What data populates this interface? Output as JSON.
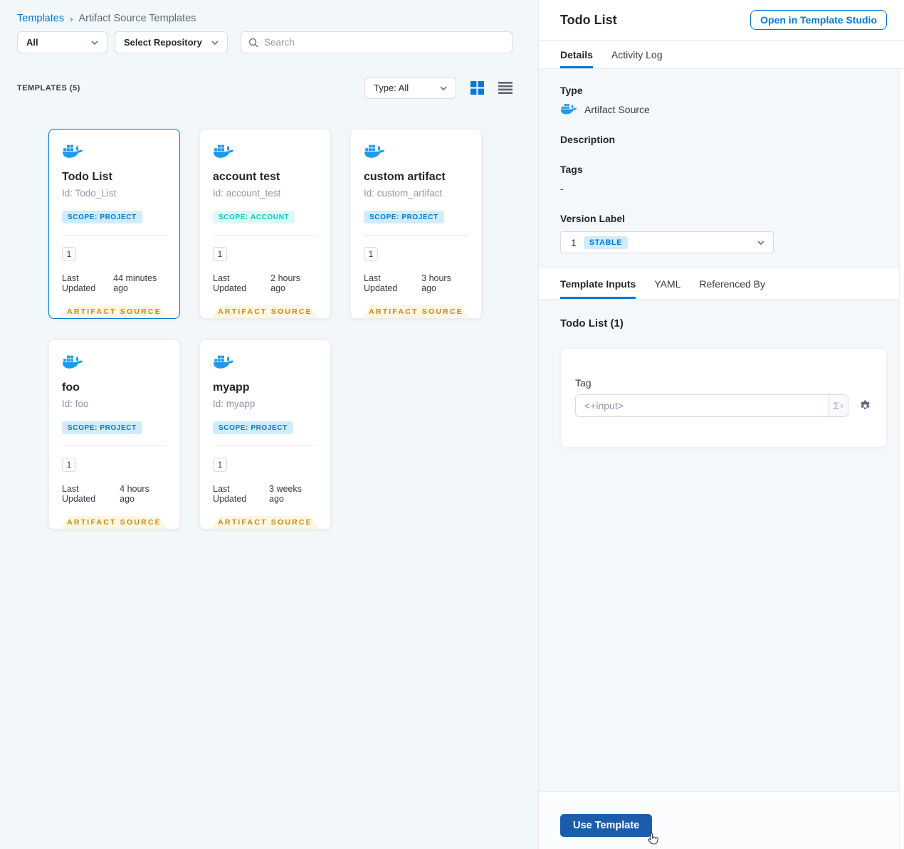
{
  "breadcrumb": {
    "root": "Templates",
    "separator": "›",
    "current": "Artifact Source Templates"
  },
  "filters": {
    "scope": "All",
    "repository": "Select Repository",
    "search_placeholder": "Search"
  },
  "list_header": {
    "count": "TEMPLATES (5)",
    "type_filter": "Type: All"
  },
  "cards": [
    {
      "title": "Todo List",
      "id": "Id: Todo_List",
      "scope": "SCOPE: PROJECT",
      "scope_type": "project",
      "version_count": "1",
      "updated_label": "Last Updated",
      "updated_value": "44 minutes ago",
      "ribbon": "ARTIFACT SOURCE",
      "selected": true
    },
    {
      "title": "account test",
      "id": "Id: account_test",
      "scope": "SCOPE: ACCOUNT",
      "scope_type": "account",
      "version_count": "1",
      "updated_label": "Last Updated",
      "updated_value": "2 hours ago",
      "ribbon": "ARTIFACT SOURCE",
      "selected": false
    },
    {
      "title": "custom artifact",
      "id": "Id: custom_artifact",
      "scope": "SCOPE: PROJECT",
      "scope_type": "project",
      "version_count": "1",
      "updated_label": "Last Updated",
      "updated_value": "3 hours ago",
      "ribbon": "ARTIFACT SOURCE",
      "selected": false
    },
    {
      "title": "foo",
      "id": "Id: foo",
      "scope": "SCOPE: PROJECT",
      "scope_type": "project",
      "version_count": "1",
      "updated_label": "Last Updated",
      "updated_value": "4 hours ago",
      "ribbon": "ARTIFACT SOURCE",
      "selected": false
    },
    {
      "title": "myapp",
      "id": "Id: myapp",
      "scope": "SCOPE: PROJECT",
      "scope_type": "project",
      "version_count": "1",
      "updated_label": "Last Updated",
      "updated_value": "3 weeks ago",
      "ribbon": "ARTIFACT SOURCE",
      "selected": false
    }
  ],
  "panel": {
    "title": "Todo List",
    "open_button": "Open in Template Studio",
    "tabs": {
      "details": "Details",
      "activity_log": "Activity Log"
    },
    "details": {
      "type_label": "Type",
      "type_value": "Artifact Source",
      "description_label": "Description",
      "tags_label": "Tags",
      "tags_value": "-",
      "version_label": "Version Label",
      "version_number": "1",
      "version_badge": "STABLE"
    },
    "sub_tabs": {
      "template_inputs": "Template Inputs",
      "yaml": "YAML",
      "referenced_by": "Referenced By"
    },
    "inputs": {
      "heading": "Todo List (1)",
      "tag_label": "Tag",
      "tag_value": "<+input>",
      "expression_sigma": "Σ",
      "expression_sup": "x"
    },
    "footer": {
      "use_template": "Use Template"
    }
  },
  "colors": {
    "primary_blue": "#0278d5",
    "docker_blue": "#1d9bf0",
    "ribbon_text": "#c8871b",
    "ribbon_bg": "#fdf6e1",
    "scope_project_bg": "#d0ecfb",
    "scope_project_text": "#0278d5",
    "scope_account_bg": "#dcfaf5",
    "scope_account_text": "#0bc8c5",
    "stable_badge_bg": "#d0ecfb",
    "use_template_bg": "#1b5cab"
  }
}
